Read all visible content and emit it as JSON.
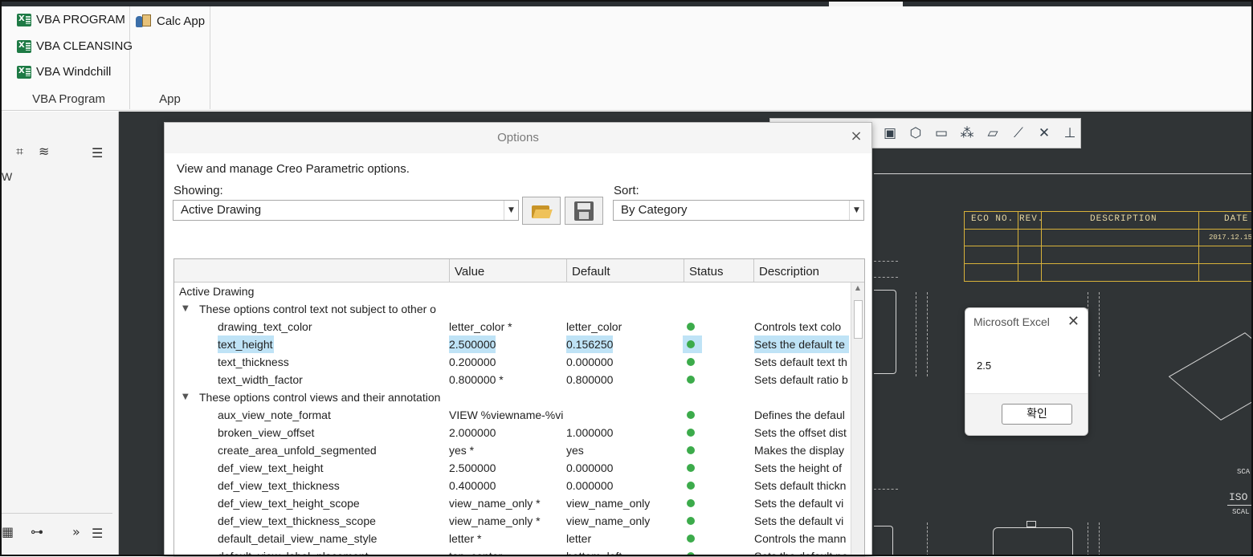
{
  "ribbon": {
    "groups": [
      {
        "label": "VBA Program",
        "buttons": [
          {
            "label": "VBA PROGRAM",
            "icon": "excel-icon"
          },
          {
            "label": "VBA CLEANSING",
            "icon": "excel-icon"
          },
          {
            "label": "VBA Windchill",
            "icon": "excel-icon"
          }
        ]
      },
      {
        "label": "App",
        "buttons": [
          {
            "label": "Calc App",
            "icon": "calculator-user-icon"
          }
        ]
      }
    ]
  },
  "left_panel": {
    "partial_text": "W"
  },
  "options_dialog": {
    "title": "Options",
    "subtitle": "View and manage Creo Parametric options.",
    "showing_label": "Showing:",
    "showing_value": "Active Drawing",
    "sort_label": "Sort:",
    "sort_value": "By Category",
    "columns": [
      "Value",
      "Default",
      "Status",
      "Description"
    ],
    "root_label": "Active Drawing",
    "rows": [
      {
        "type": "category",
        "name": "These options control text not subject to other o"
      },
      {
        "type": "option",
        "name": "drawing_text_color",
        "value": "letter_color *",
        "default": "letter_color",
        "description": "Controls text colo"
      },
      {
        "type": "option",
        "name": "text_height",
        "value": "2.500000",
        "default": "0.156250",
        "description": "Sets the default te",
        "selected": true
      },
      {
        "type": "option",
        "name": "text_thickness",
        "value": "0.200000",
        "default": "0.000000",
        "description": "Sets default text th"
      },
      {
        "type": "option",
        "name": "text_width_factor",
        "value": "0.800000 *",
        "default": "0.800000",
        "description": "Sets default ratio b"
      },
      {
        "type": "category",
        "name": "These options control views and their annotation"
      },
      {
        "type": "option",
        "name": "aux_view_note_format",
        "value": "VIEW %viewname-%vi",
        "default": "",
        "description": "Defines the defaul"
      },
      {
        "type": "option",
        "name": "broken_view_offset",
        "value": "2.000000",
        "default": "1.000000",
        "description": "Sets the offset dist"
      },
      {
        "type": "option",
        "name": "create_area_unfold_segmented",
        "value": "yes *",
        "default": "yes",
        "description": "Makes the display"
      },
      {
        "type": "option",
        "name": "def_view_text_height",
        "value": "2.500000",
        "default": "0.000000",
        "description": "Sets the height of"
      },
      {
        "type": "option",
        "name": "def_view_text_thickness",
        "value": "0.400000",
        "default": "0.000000",
        "description": "Sets default thickn"
      },
      {
        "type": "option",
        "name": "def_view_text_height_scope",
        "value": "view_name_only *",
        "default": "view_name_only",
        "description": "Sets the default vi"
      },
      {
        "type": "option",
        "name": "def_view_text_thickness_scope",
        "value": "view_name_only *",
        "default": "view_name_only",
        "description": "Sets the default vi"
      },
      {
        "type": "option",
        "name": "default_detail_view_name_style",
        "value": "letter *",
        "default": "letter",
        "description": "Controls the mann"
      },
      {
        "type": "option",
        "name": "default_view_label_placement",
        "value": "top_center",
        "default": "bottom_left",
        "description": "Sets the default pe"
      }
    ]
  },
  "drawing": {
    "title_block_headers": [
      "ECO NO.",
      "REV.",
      "DESCRIPTION",
      "DATE"
    ],
    "title_block_date": "2017.12.15",
    "right_texts": [
      "SCA",
      "ISO",
      "SCAL"
    ]
  },
  "excel_msgbox": {
    "title": "Microsoft Excel",
    "message": "2.5",
    "ok_label": "확인"
  },
  "colors": {
    "canvas": "#303436",
    "status_ok": "#3cab4b",
    "selection": "#bfe3f6",
    "title_block": "#d8b23a"
  }
}
